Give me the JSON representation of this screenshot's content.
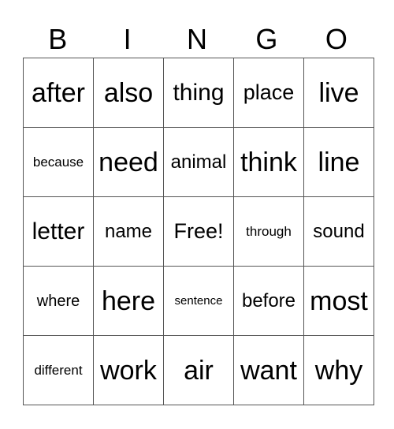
{
  "header": [
    "B",
    "I",
    "N",
    "G",
    "O"
  ],
  "rows": [
    [
      "after",
      "also",
      "thing",
      "place",
      "live"
    ],
    [
      "because",
      "need",
      "animal",
      "think",
      "line"
    ],
    [
      "letter",
      "name",
      "Free!",
      "through",
      "sound"
    ],
    [
      "where",
      "here",
      "sentence",
      "before",
      "most"
    ],
    [
      "different",
      "work",
      "air",
      "want",
      "why"
    ]
  ]
}
